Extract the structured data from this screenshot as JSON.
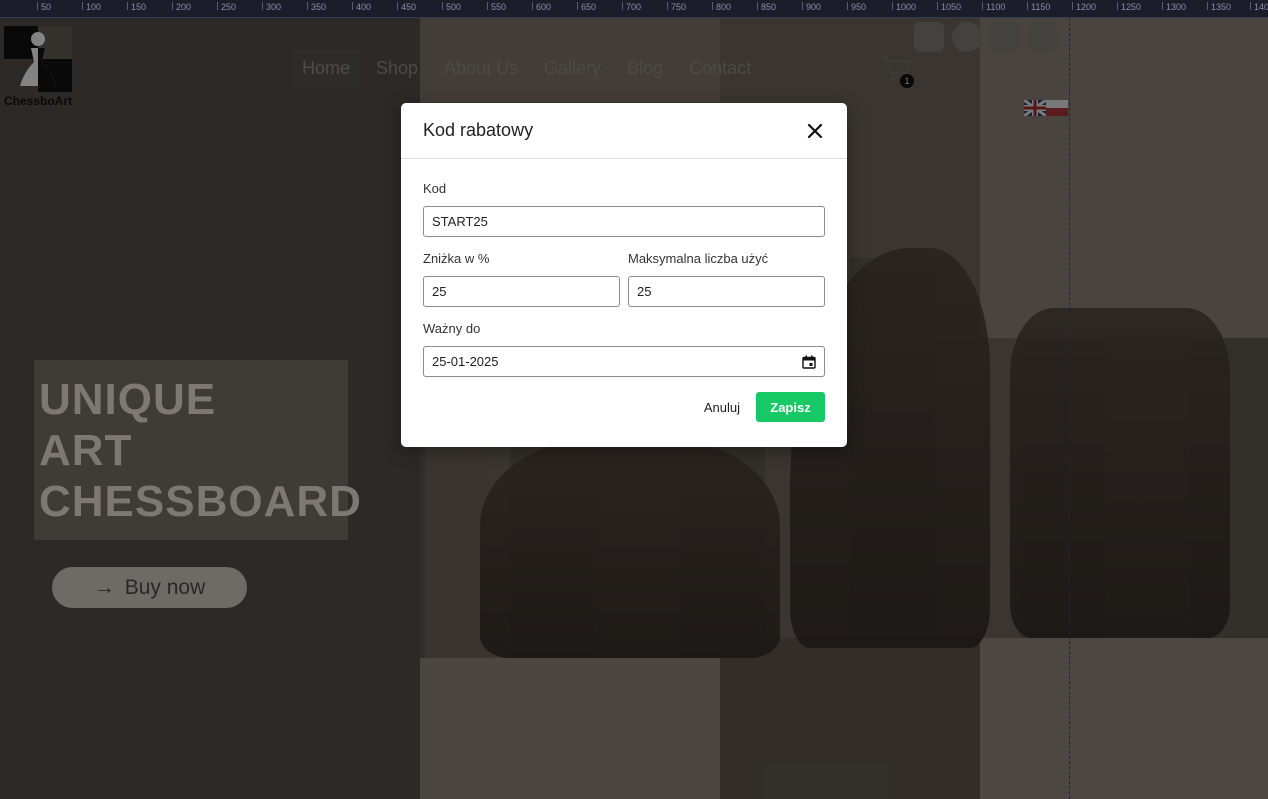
{
  "ruler": {
    "ticks": [
      "50",
      "100",
      "150",
      "200",
      "250",
      "300",
      "350",
      "400",
      "450",
      "500",
      "550",
      "600",
      "650",
      "700",
      "750",
      "800",
      "850",
      "900",
      "950",
      "1000",
      "1050",
      "1100",
      "1150",
      "1200",
      "1250",
      "1300",
      "1350",
      "140"
    ]
  },
  "logo": {
    "text": "ChessboArt"
  },
  "nav": [
    {
      "label": "Home",
      "active": true
    },
    {
      "label": "Shop"
    },
    {
      "label": "About Us"
    },
    {
      "label": "Gallery"
    },
    {
      "label": "Blog"
    },
    {
      "label": "Contact"
    }
  ],
  "cart": {
    "count": "1"
  },
  "socials": [
    "youtube-icon",
    "facebook-icon",
    "linkedin-icon",
    "instagram-icon"
  ],
  "flags": [
    "uk-flag-icon",
    "poland-flag-icon"
  ],
  "hero": {
    "lines": [
      "UNIQUE",
      "ART",
      "CHESSBOARD"
    ],
    "cta": "Buy now",
    "cta_icon": "→"
  },
  "modal": {
    "title": "Kod rabatowy",
    "code_label": "Kod",
    "code_value": "START25",
    "discount_label": "Zniżka w %",
    "discount_value": "25",
    "max_uses_label": "Maksymalna liczba użyć",
    "max_uses_value": "25",
    "valid_label": "Ważny do",
    "valid_value": "25-01-2025",
    "cancel_label": "Anuluj",
    "save_label": "Zapisz"
  },
  "colors": {
    "save": "#17c964",
    "overlay": "rgba(0,0,0,0.45)"
  }
}
